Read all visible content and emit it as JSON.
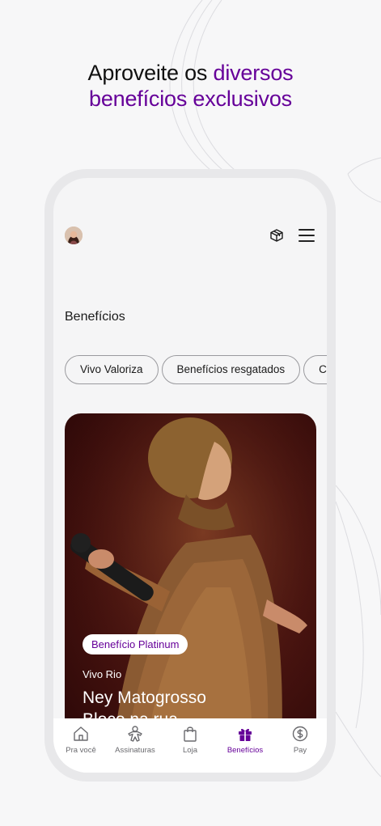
{
  "headline": {
    "line1_plain": "Aproveite os ",
    "line1_accent": "diversos",
    "line2_accent": "benefícios exclusivos"
  },
  "header": {
    "avatar_icon": "user-avatar",
    "gift_icon": "gift-box-icon",
    "menu_icon": "hamburger-menu-icon"
  },
  "page": {
    "title": "Benefícios"
  },
  "chips": [
    "Vivo Valoriza",
    "Benefícios resgatados",
    "Categorias"
  ],
  "card": {
    "badge": "Benefício Platinum",
    "subtitle": "Vivo Rio",
    "title_line1": "Ney Matogrosso",
    "title_line2": "Bloco na rua"
  },
  "tabs": [
    {
      "label": "Pra você",
      "icon": "home-icon",
      "active": false
    },
    {
      "label": "Assinaturas",
      "icon": "gingerbread-icon",
      "active": false
    },
    {
      "label": "Loja",
      "icon": "shopping-bag-icon",
      "active": false
    },
    {
      "label": "Benefícios",
      "icon": "gift-icon",
      "active": true
    },
    {
      "label": "Pay",
      "icon": "dollar-coin-icon",
      "active": false
    }
  ],
  "colors": {
    "brand": "#660099",
    "card_bg": "#3a0d0b",
    "background": "#f7f7f8"
  }
}
